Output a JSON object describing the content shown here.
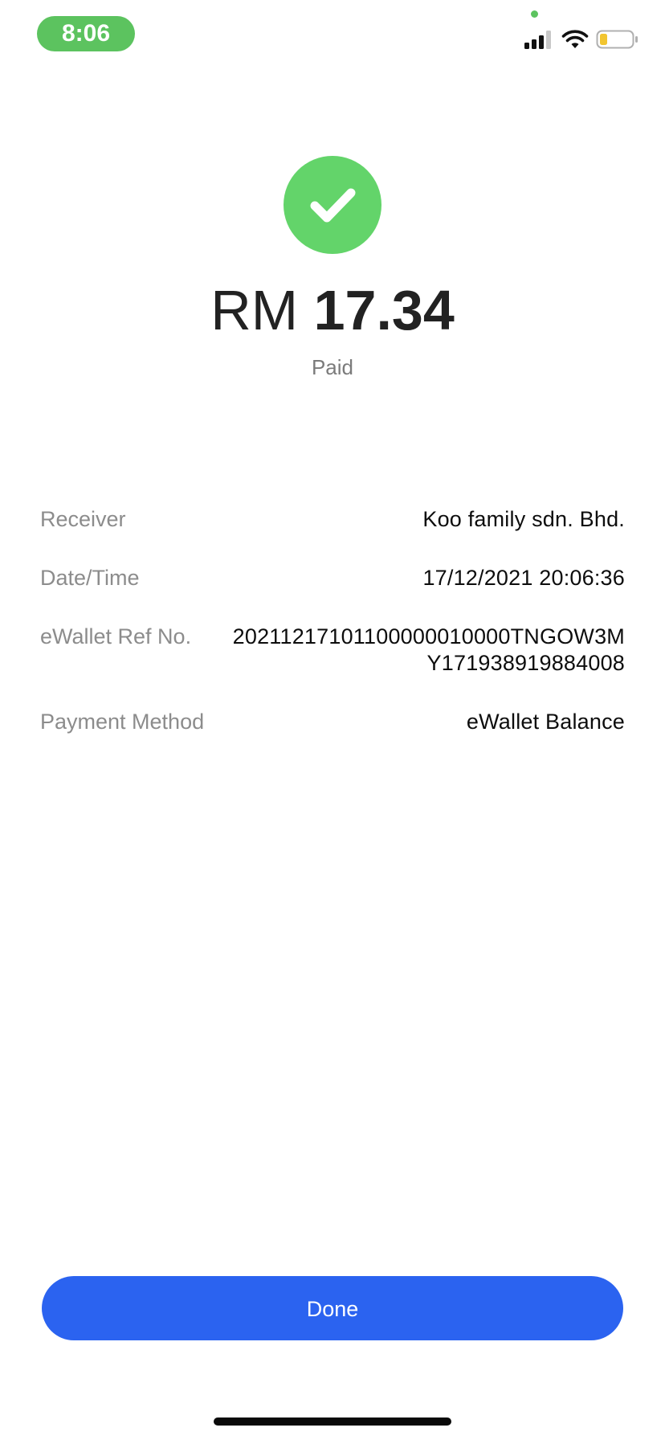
{
  "status_bar": {
    "time": "8:06",
    "icons": [
      "privacy-dot",
      "cellular-signal-icon",
      "wifi-icon",
      "battery-icon"
    ]
  },
  "payment": {
    "icon": "check-circle-icon",
    "currency": "RM",
    "amount": "17.34",
    "status": "Paid"
  },
  "details": {
    "receiver": {
      "label": "Receiver",
      "value": "Koo family sdn. Bhd."
    },
    "datetime": {
      "label": "Date/Time",
      "value": "17/12/2021 20:06:36"
    },
    "ref": {
      "label": "eWallet Ref No.",
      "value": "20211217101100000010000TNGOW3MY171938919884008"
    },
    "method": {
      "label": "Payment Method",
      "value": "eWallet Balance"
    }
  },
  "actions": {
    "done_label": "Done"
  },
  "colors": {
    "success_green": "#63d46a",
    "primary_blue": "#2b63f0",
    "status_pill_green": "#5cc35f",
    "battery_low_yellow": "#f2c530"
  }
}
